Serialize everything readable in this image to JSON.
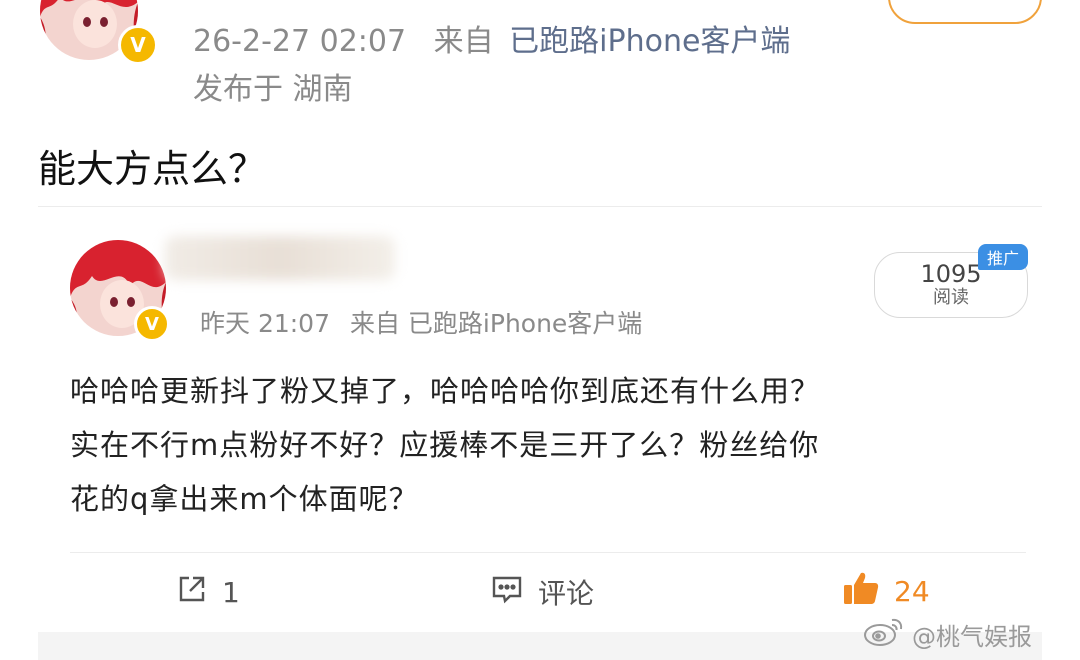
{
  "post1": {
    "timestamp": "26-2-27 02:07",
    "from_label": "来自",
    "source": "已跑路iPhone客户端",
    "location": "发布于 湖南",
    "text": "能大方点么？"
  },
  "post2": {
    "timestamp": "昨天 21:07",
    "from_label": "来自",
    "source": "已跑路iPhone客户端",
    "read_count": "1095",
    "read_label": "阅读",
    "promo_badge": "推广",
    "text_lines": [
      "哈哈哈更新抖了粉又掉了，哈哈哈哈你到底还有什么用？",
      "实在不行m点粉好不好？应援棒不是三开了么？粉丝给你",
      "花的q拿出来m个体面呢？"
    ]
  },
  "actions": {
    "repost_count": "1",
    "comment_label": "评论",
    "like_count": "24"
  },
  "badge_text": "V",
  "watermark": "@桃气娱报",
  "colors": {
    "verified": "#f5b800",
    "like": "#f08a24",
    "source_link": "#5e6e8c",
    "promo": "#3b8fe4"
  },
  "icons": [
    "verified-badge-icon",
    "repost-icon",
    "comment-icon",
    "like-icon",
    "weibo-logo-icon"
  ]
}
